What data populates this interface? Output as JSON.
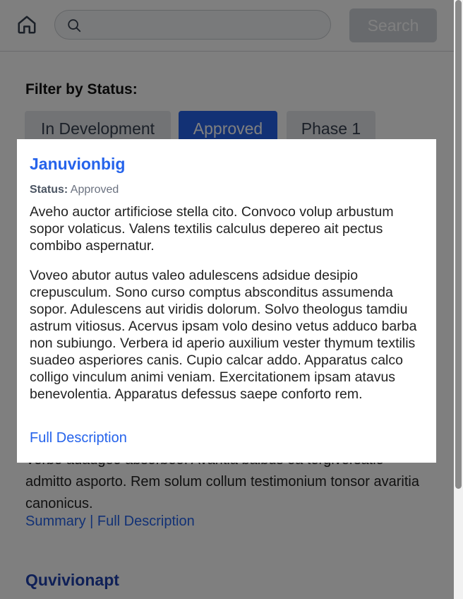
{
  "header": {
    "home_icon": "home-icon",
    "search_icon": "search-icon",
    "search_value": "",
    "search_placeholder": "",
    "search_button_label": "Search"
  },
  "filter": {
    "label": "Filter by Status:",
    "chips": [
      {
        "label": "In Development",
        "selected": false
      },
      {
        "label": "Approved",
        "selected": true
      },
      {
        "label": "Phase 1",
        "selected": false
      }
    ]
  },
  "background_item": {
    "text_partial": "Verbo adaugeo absorbeo. Avaritia balbus ea tergiversatio admitto asporto. Rem solum collum testimonium tonsor avaritia canonicus.",
    "link_summary": "Summary",
    "link_separator": " | ",
    "link_full": "Full Description"
  },
  "next_item": {
    "title": "Quvivionapt"
  },
  "popup": {
    "title": "Januvionbig",
    "status_label": "Status:",
    "status_value": "Approved",
    "summary": "Aveho auctor artificiose stella cito. Convoco volup arbustum sopor volaticus. Valens textilis calculus depereo ait pectus combibo aspernatur.",
    "description": "Voveo abutor autus valeo adulescens adsidue desipio crepusculum. Sono curso comptus absconditus assumenda sopor. Adulescens aut viridis dolorum. Solvo theologus tamdiu astrum vitiosus. Acervus ipsam volo desino vetus adduco barba non subiungo. Verbera id aperio auxilium vester thymum textilis suadeo asperiores canis. Cupio calcar addo. Apparatus calco colligo vinculum animi veniam. Exercitationem ipsam atavus benevolentia. Apparatus defessus saepe conforto rem.",
    "link": "Full Description"
  },
  "colors": {
    "accent": "#2563eb",
    "overlay": "rgba(0,0,0,0.5)"
  }
}
